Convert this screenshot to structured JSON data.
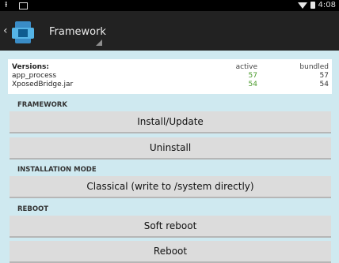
{
  "statusbar": {
    "time": "4:08"
  },
  "actionbar": {
    "title": "Framework"
  },
  "versions": {
    "header": {
      "name": "Versions:",
      "active": "active",
      "bundled": "bundled"
    },
    "rows": [
      {
        "name": "app_process",
        "active": "57",
        "bundled": "57"
      },
      {
        "name": "XposedBridge.jar",
        "active": "54",
        "bundled": "54"
      }
    ]
  },
  "sections": {
    "framework": "FRAMEWORK",
    "installation_mode": "INSTALLATION MODE",
    "reboot": "REBOOT"
  },
  "buttons": {
    "install_update": "Install/Update",
    "uninstall": "Uninstall",
    "installation_mode": "Classical (write to /system directly)",
    "soft_reboot": "Soft reboot",
    "reboot": "Reboot"
  },
  "colors": {
    "background": "#cfe9f0",
    "actionbar": "#222222",
    "statusbar": "#000000",
    "active_version": "#4a9a2b",
    "button": "#dcdcdc"
  },
  "icons": {
    "statusbar_left": [
      "upload-icon",
      "image-icon"
    ],
    "statusbar_right": [
      "wifi-icon",
      "battery-icon"
    ],
    "actionbar": [
      "back-icon",
      "app-icon",
      "dropdown-indicator-icon"
    ]
  }
}
